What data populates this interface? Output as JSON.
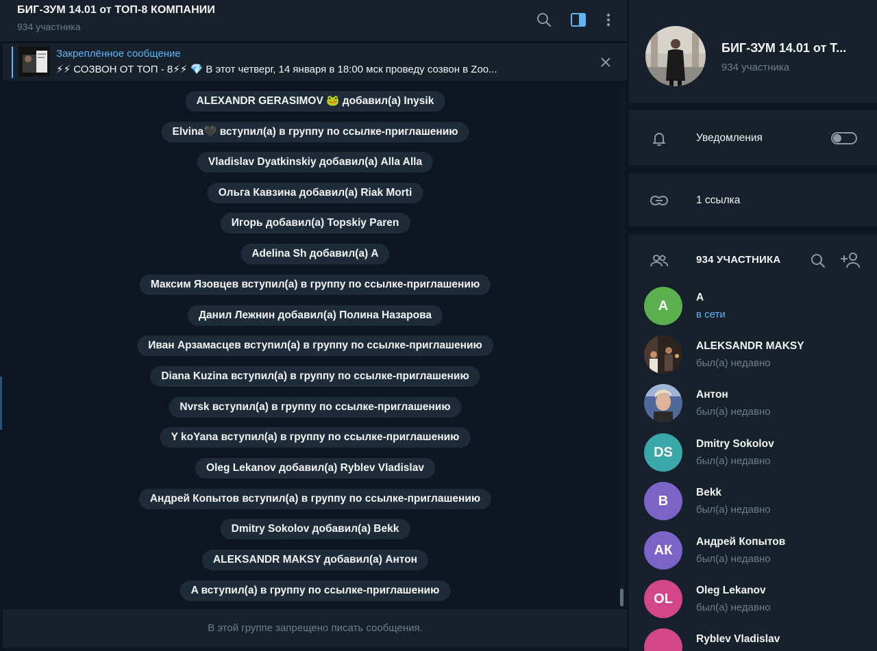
{
  "header": {
    "title": "БИГ-ЗУМ 14.01 от ТОП-8 КОМПАНИИ",
    "subtitle": "934 участника"
  },
  "pinned": {
    "label": "Закреплённое сообщение",
    "text": "⚡⚡ СОЗВОН ОТ ТОП - 8⚡⚡ 💎 В этот четверг, 14 января в 18:00 мск проведу созвон в Zoo..."
  },
  "messages": [
    "ALEXANDR GERASIMOV 🐸 добавил(а) Inysik",
    "Elvina🖤 вступил(а) в группу по ссылке-приглашению",
    "Vladislav Dyatkinskiy добавил(а) Alla Alla",
    "Ольга Кавзина добавил(а) Riak Morti",
    "Игорь добавил(а) Topskiy Paren",
    "Adelina Sh добавил(а) A",
    "Максим Язовцев вступил(а) в группу по ссылке-приглашению",
    "Данил Лежнин добавил(а) Полина Назарова",
    "Иван Арзамасцев вступил(а) в группу по ссылке-приглашению",
    "Diana Kuzina вступил(а) в группу по ссылке-приглашению",
    "Nvrsk вступил(а) в группу по ссылке-приглашению",
    "Y koYana вступил(а) в группу по ссылке-приглашению",
    "Oleg Lekanov добавил(а) Ryblev Vladislav",
    "Андрей Копытов вступил(а) в группу по ссылке-приглашению",
    "Dmitry Sokolov добавил(а) Bekk",
    "ALEKSANDR MAKSY добавил(а) Антон",
    "A вступил(а) в группу по ссылке-приглашению"
  ],
  "bottom_notice": "В этой группе запрещено писать сообщения.",
  "panel": {
    "group_name": "БИГ-ЗУМ 14.01 от Т...",
    "group_count": "934 участника",
    "notifications_label": "Уведомления",
    "notifications_enabled": false,
    "links_label": "1 ссылка",
    "members_title": "934 УЧАСТНИКА",
    "members": [
      {
        "initials": "A",
        "name": "A",
        "status": "в сети",
        "color": "#5caf4f",
        "online": true,
        "photo": false
      },
      {
        "initials": "",
        "name": "ALEKSANDR MAKSY",
        "status": "был(а) недавно",
        "color": "#4a3a32",
        "online": false,
        "photo": true
      },
      {
        "initials": "",
        "name": "Антон",
        "status": "был(а) недавно",
        "color": "#3a4a66",
        "online": false,
        "photo": true
      },
      {
        "initials": "DS",
        "name": "Dmitry Sokolov",
        "status": "был(а) недавно",
        "color": "#3aa8a8",
        "online": false,
        "photo": false
      },
      {
        "initials": "B",
        "name": "Bekk",
        "status": "был(а) недавно",
        "color": "#7b63c8",
        "online": false,
        "photo": false
      },
      {
        "initials": "АК",
        "name": "Андрей Копытов",
        "status": "был(а) недавно",
        "color": "#7b63c8",
        "online": false,
        "photo": false
      },
      {
        "initials": "OL",
        "name": "Oleg Lekanov",
        "status": "был(а) недавно",
        "color": "#d4468a",
        "online": false,
        "photo": false
      },
      {
        "initials": "RV",
        "name": "Ryblev Vladislav",
        "status": "",
        "color": "#d4468a",
        "online": false,
        "photo": false
      }
    ]
  },
  "colors": {
    "accent": "#5eb5f7",
    "background": "#0e1621",
    "panel": "#17212b",
    "service_bubble": "#1e2c3a",
    "muted_text": "#6d7f8f"
  }
}
